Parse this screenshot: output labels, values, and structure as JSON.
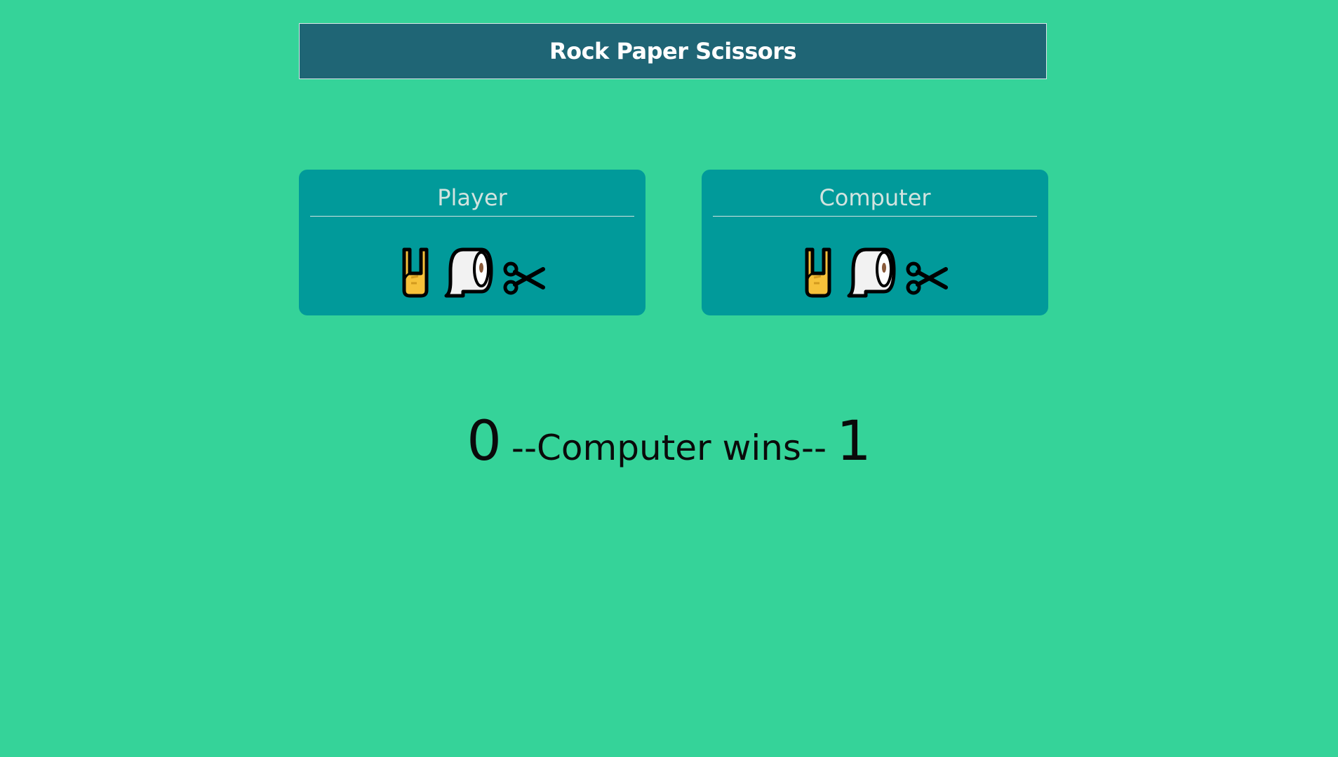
{
  "header": {
    "title": "Rock Paper Scissors"
  },
  "player": {
    "label": "Player",
    "choices": [
      "rock-hand-icon",
      "paper-roll-icon",
      "scissors-icon"
    ]
  },
  "computer": {
    "label": "Computer",
    "choices": [
      "rock-hand-icon",
      "paper-roll-icon",
      "scissors-icon"
    ]
  },
  "scoreboard": {
    "player_score": "0",
    "result": "--Computer wins--",
    "computer_score": "1"
  },
  "colors": {
    "background": "#35d399",
    "header": "#1f6575",
    "panel": "#019a9a",
    "panel_text": "#d2e3df"
  }
}
